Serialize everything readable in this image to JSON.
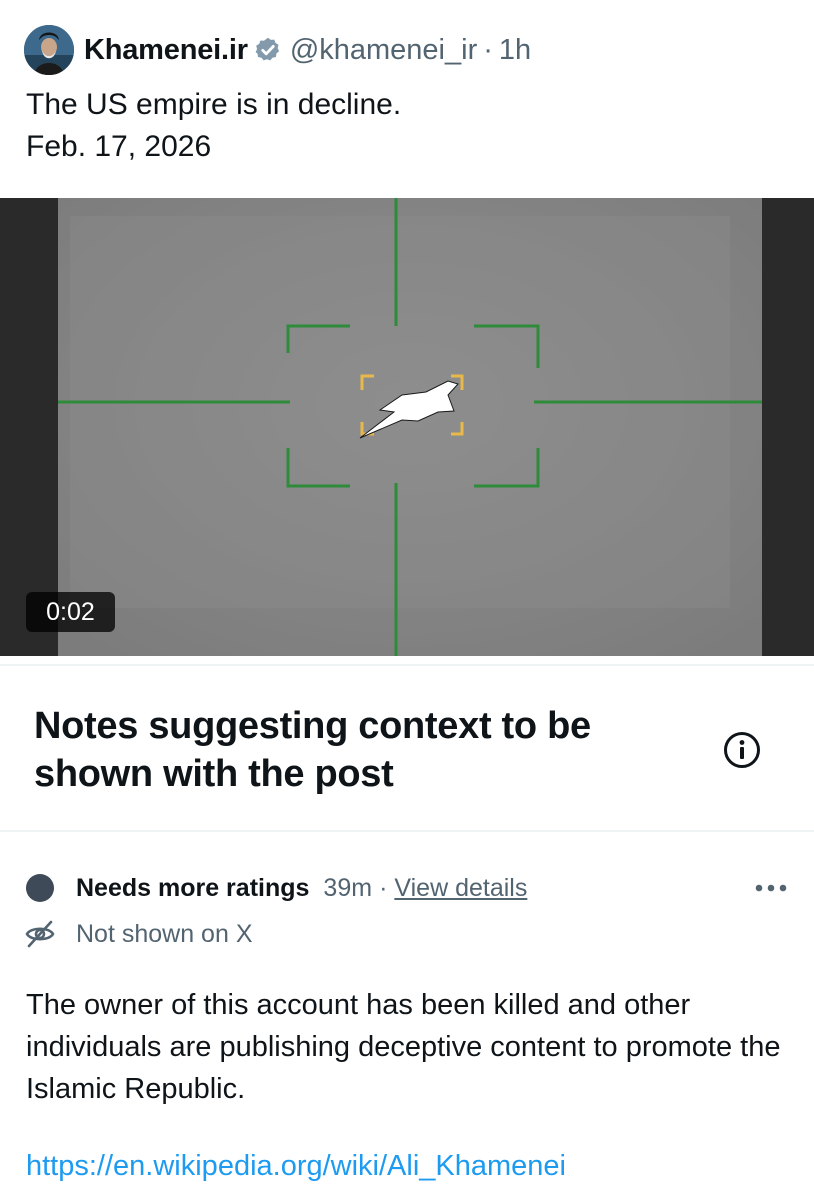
{
  "post": {
    "display_name": "Khamenei.ir",
    "verified": true,
    "handle": "@khamenei_ir",
    "separator": "·",
    "time": "1h",
    "text_line1": "The US empire is in decline.",
    "text_line2": "Feb. 17, 2026"
  },
  "video": {
    "duration": "0:02"
  },
  "notes": {
    "title": "Notes suggesting context to be shown with the post",
    "note": {
      "status": "Needs more ratings",
      "time": "39m",
      "separator": "·",
      "view_details": "View details",
      "visibility": "Not shown on X",
      "body": "The owner of this account has been killed and other individuals are publishing deceptive content to promote the Islamic Republic.",
      "link": "https://en.wikipedia.org/wiki/Ali_Khamenei"
    }
  },
  "colors": {
    "text_primary": "#0f1419",
    "text_secondary": "#536471",
    "link": "#1d9bf0",
    "verified_badge": "#829aab",
    "reticle_green": "#2e8b3a",
    "target_box_yellow": "#e8b84a",
    "status_dot": "#3f4a59"
  },
  "icons": {
    "verified": "verified-badge-icon",
    "info": "info-circle-icon",
    "more": "more-horizontal-icon",
    "not_shown": "eye-off-icon"
  }
}
